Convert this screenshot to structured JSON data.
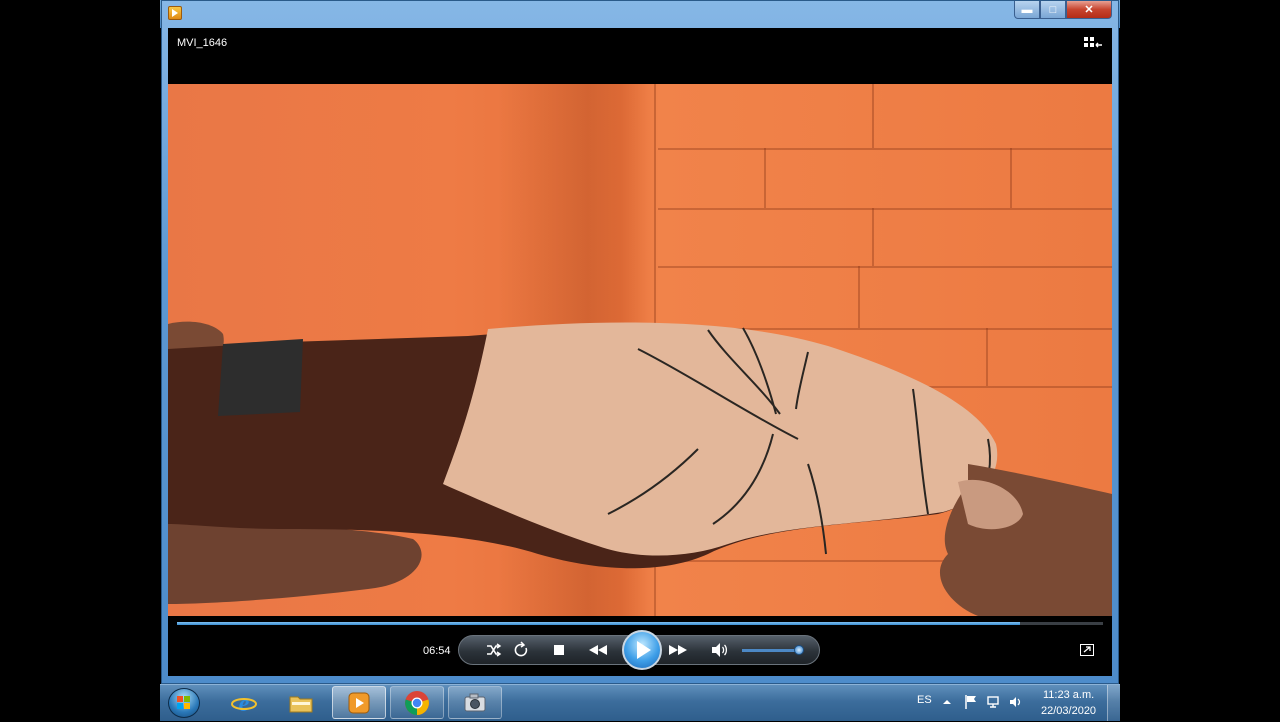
{
  "window": {
    "caption_buttons": {
      "minimize": "▬",
      "maximize": "□",
      "close": "✕"
    }
  },
  "player": {
    "title": "MVI_1646",
    "elapsed_time": "06:54",
    "seek_progress_percent": 91,
    "volume_percent": 95,
    "icons": {
      "shuffle": "shuffle-icon",
      "repeat": "repeat-icon",
      "stop": "stop-icon",
      "previous": "rewind-icon",
      "play": "play-icon",
      "next": "fast-forward-icon",
      "mute": "speaker-icon",
      "library": "switch-to-library-icon",
      "now_playing_mode": "switch-to-now-playing-icon"
    }
  },
  "taskbar": {
    "apps": [
      {
        "name": "internet-explorer",
        "state": "pinned"
      },
      {
        "name": "windows-explorer",
        "state": "pinned"
      },
      {
        "name": "windows-media-player",
        "state": "active"
      },
      {
        "name": "google-chrome",
        "state": "open"
      },
      {
        "name": "camera-app",
        "state": "open"
      }
    ],
    "tray": {
      "language": "ES",
      "time": "11:23 a.m.",
      "date": "22/03/2020"
    }
  },
  "colors": {
    "taskbar": "#3c6d9c",
    "seek_fill": "#3b8ed0",
    "wall": "#ec7a42"
  }
}
